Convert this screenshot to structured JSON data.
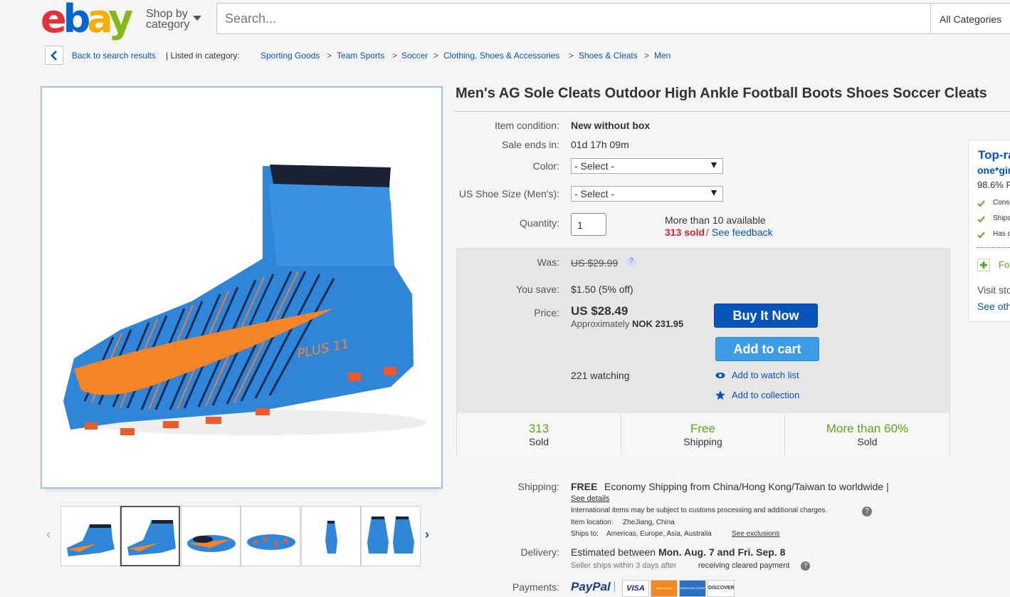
{
  "header": {
    "logo": {
      "e": "e",
      "b": "b",
      "a": "a",
      "y": "y"
    },
    "shop_by_line1": "Shop by",
    "shop_by_line2": "category",
    "search_placeholder": "Search...",
    "category_select": "All Categories"
  },
  "breadcrumb": {
    "back": "Back to search results",
    "listed_in": "| Listed in category:",
    "items": [
      "Sporting Goods",
      "Team Sports",
      "Soccer",
      "Clothing, Shoes & Accessories",
      "Shoes & Cleats",
      "Men"
    ],
    "separator": ">"
  },
  "gallery": {
    "prev": "‹",
    "next": "›"
  },
  "item": {
    "title": "Men's AG Sole Cleats Outdoor High Ankle Football Boots Shoes Soccer Cleats",
    "condition_label": "Item condition:",
    "condition": "New without box",
    "sale_ends_label": "Sale ends in:",
    "sale_ends": "01d 17h 09m",
    "color_label": "Color:",
    "color_select": "- Select -",
    "size_label": "US Shoe Size (Men's):",
    "size_select": "- Select -",
    "quantity_label": "Quantity:",
    "quantity": "1",
    "available": "More than 10 available",
    "sold": "313 sold",
    "slash": " / ",
    "feedback": "See feedback"
  },
  "price": {
    "was_label": "Was:",
    "was": "US $29.99",
    "save_label": "You save:",
    "save": "$1.50 (5% off)",
    "price_label": "Price:",
    "price": "US $28.49",
    "approx_prefix": "Approximately ",
    "approx": "NOK 231.95",
    "buy_now": "Buy It Now",
    "add_cart": "Add to cart",
    "watching": "221 watching",
    "watch_list": "Add to watch list",
    "collection": "Add to collection"
  },
  "stats": [
    {
      "n": "313",
      "s": "Sold"
    },
    {
      "n": "Free",
      "s": "Shipping"
    },
    {
      "n": "More than 60%",
      "s": "Sold"
    }
  ],
  "shipping": {
    "label": "Shipping:",
    "free": "FREE",
    "desc": "Economy Shipping from China/Hong Kong/Taiwan to worldwide |",
    "details": "See details",
    "intl": "International items may be subject to customs processing and additional charges.",
    "location_label": "Item location:",
    "location": "ZheJiang, China",
    "ships_label": "Ships to:",
    "ships": "Americas, Europe, Asia, Australia",
    "exclusions": "See exclusions"
  },
  "delivery": {
    "label": "Delivery:",
    "prefix": "Estimated between ",
    "dates": "Mon. Aug. 7 and Fri. Sep. 8",
    "note": "Seller ships within 3 days after",
    "note_link": "receiving cleared payment"
  },
  "payments": {
    "label": "Payments:",
    "paypal": "PayPal",
    "visa": "VISA",
    "mastercard": "MasterCard",
    "amex": "AMERICAN EXPRESS",
    "discover": "DISCOVER"
  },
  "seller": {
    "top_rated": "Top-ra",
    "name": "one*gir",
    "positive": "98.6% P",
    "feat1": "Cons",
    "feat2": "Ships",
    "feat3": "Has c",
    "follow": "Fol",
    "visit": "Visit sto",
    "see_other": "See oth"
  }
}
